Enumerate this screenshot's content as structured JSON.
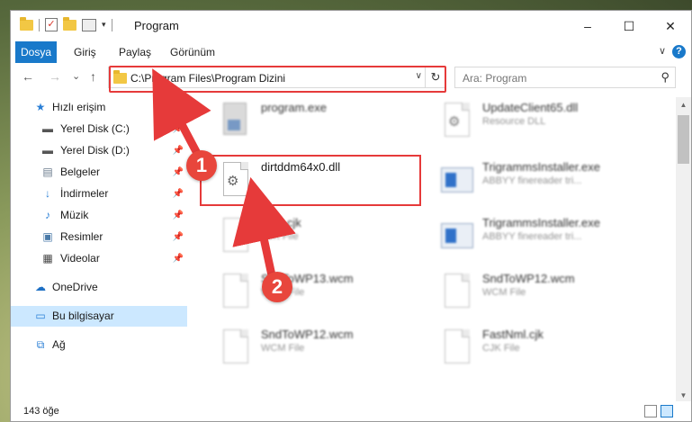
{
  "window": {
    "title": "Program",
    "controls": {
      "minimize": "–",
      "maximize": "☐",
      "close": "✕"
    }
  },
  "ribbon": {
    "tabs": [
      "Dosya",
      "Giriş",
      "Paylaş",
      "Görünüm"
    ],
    "collapse": "∨",
    "help": "?"
  },
  "nav": {
    "back": "←",
    "forward": "→",
    "recent": "⌄",
    "up": "↑"
  },
  "address": {
    "path": "C:\\Program Files\\Program Dizini",
    "dropdown": "∨",
    "refresh": "↻"
  },
  "search": {
    "placeholder": "Ara: Program",
    "icon": "search-icon"
  },
  "sidebar": {
    "items": [
      {
        "label": "Hızlı erişim",
        "icon": "star-icon",
        "pinned": false
      },
      {
        "label": "Yerel Disk (C:)",
        "icon": "drive-icon",
        "pinned": true
      },
      {
        "label": "Yerel Disk (D:)",
        "icon": "drive-icon",
        "pinned": true
      },
      {
        "label": "Belgeler",
        "icon": "document-icon",
        "pinned": true
      },
      {
        "label": "İndirmeler",
        "icon": "download-icon",
        "pinned": true
      },
      {
        "label": "Müzik",
        "icon": "music-icon",
        "pinned": true
      },
      {
        "label": "Resimler",
        "icon": "picture-icon",
        "pinned": true
      },
      {
        "label": "Videolar",
        "icon": "video-icon",
        "pinned": true
      },
      {
        "label": "OneDrive",
        "icon": "cloud-icon",
        "pinned": false
      },
      {
        "label": "Bu bilgisayar",
        "icon": "computer-icon",
        "pinned": false,
        "selected": true
      },
      {
        "label": "Ağ",
        "icon": "network-icon",
        "pinned": false
      }
    ]
  },
  "files": [
    {
      "name": "program.exe",
      "type": "",
      "icon": "exe-icon"
    },
    {
      "name": "UpdateClient65.dll",
      "type": "Resource DLL",
      "icon": "dll-icon"
    },
    {
      "name": "dirtddm64x0.dll",
      "type": "",
      "icon": "dll-icon"
    },
    {
      "name": "TrigrammsInstaller.exe",
      "type": "ABBYY finereader tri...",
      "icon": "app-icon"
    },
    {
      "name": "...an.cjk",
      "type": "CJK File",
      "icon": "file-icon"
    },
    {
      "name": "TrigrammsInstaller.exe",
      "type": "ABBYY finereader tri...",
      "icon": "app-icon"
    },
    {
      "name": "SndToWP13.wcm",
      "type": "WCM File",
      "icon": "file-icon"
    },
    {
      "name": "SndToWP12.wcm",
      "type": "WCM File",
      "icon": "file-icon"
    },
    {
      "name": "SndToWP12.wcm",
      "type": "WCM File",
      "icon": "file-icon"
    },
    {
      "name": "FastNml.cjk",
      "type": "CJK File",
      "icon": "file-icon"
    }
  ],
  "status": {
    "count": "143 öğe"
  },
  "annotations": {
    "badge1": "1",
    "badge2": "2",
    "color": "#e63a3a"
  }
}
